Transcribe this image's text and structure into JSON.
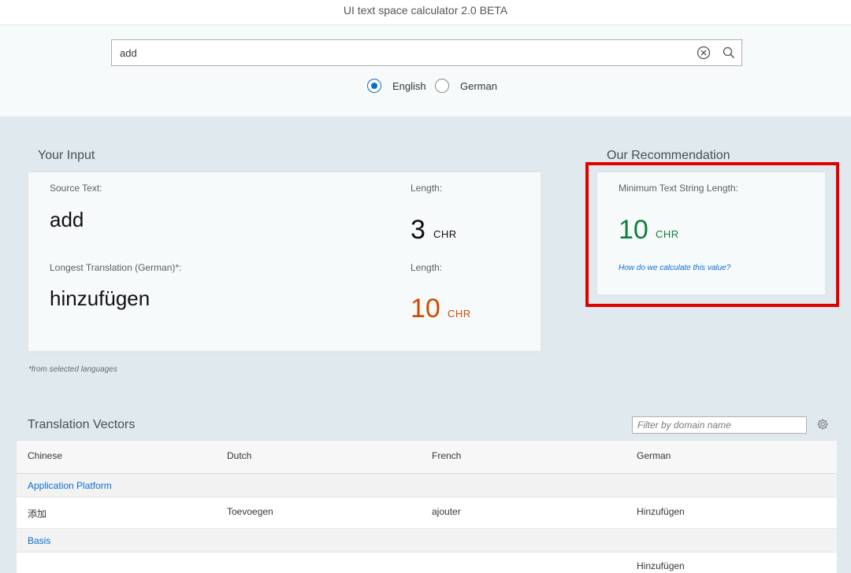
{
  "app": {
    "title": "UI text space calculator 2.0 BETA"
  },
  "search": {
    "value": "add"
  },
  "languages": [
    {
      "label": "English",
      "selected": true
    },
    {
      "label": "German",
      "selected": false
    }
  ],
  "input_section": {
    "title": "Your Input",
    "source_label": "Source Text:",
    "source_text": "add",
    "length_label": "Length:",
    "source_length": "3",
    "unit": "CHR",
    "longest_label": "Longest Translation (German)*:",
    "longest_text": "hinzufügen",
    "longest_length_label": "Length:",
    "longest_length": "10",
    "longest_unit": "CHR",
    "footnote": "*from selected languages"
  },
  "recommendation": {
    "title": "Our Recommendation",
    "label": "Minimum Text String Length:",
    "value": "10",
    "unit": "CHR",
    "link": "How do we calculate this value?"
  },
  "vectors": {
    "title": "Translation Vectors",
    "filter_placeholder": "Filter by domain name",
    "columns": [
      "Chinese",
      "Dutch",
      "French",
      "German"
    ],
    "groups": [
      {
        "name": "Application Platform",
        "rows": [
          [
            "添加",
            "Toevoegen",
            "ajouter",
            "Hinzufügen"
          ]
        ]
      },
      {
        "name": "Basis",
        "rows": [
          [
            "",
            "",
            "",
            "Hinzufügen"
          ]
        ]
      }
    ]
  },
  "colors": {
    "accent": "#0a6ed1",
    "orange": "#d04a02",
    "green": "#107e3e",
    "highlight": "#e00000"
  }
}
